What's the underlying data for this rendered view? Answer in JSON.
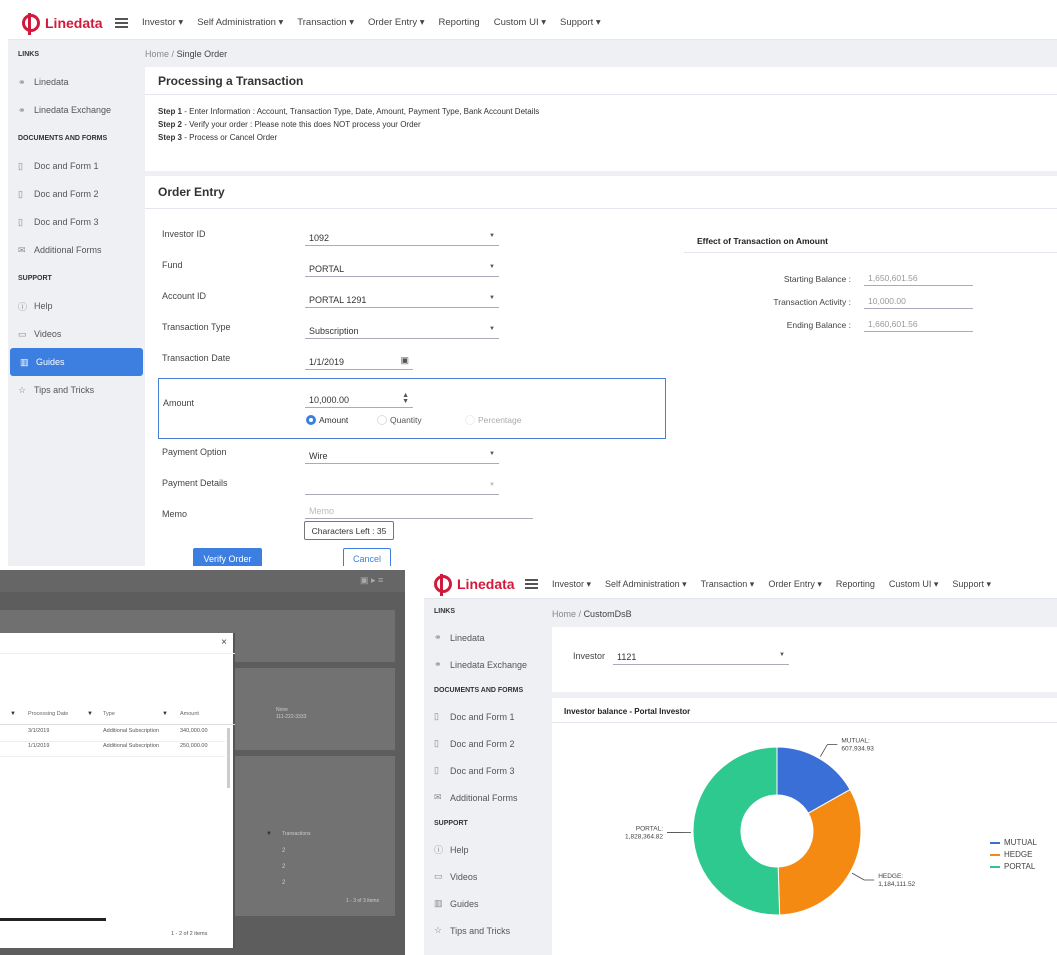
{
  "win1": {
    "logo": "Linedata",
    "menu": [
      "Investor ▾",
      "Self Administration ▾",
      "Transaction ▾",
      "Order Entry ▾",
      "Reporting",
      "Custom UI ▾",
      "Support ▾"
    ],
    "sidebar": {
      "links_title": "LINKS",
      "link1": "Linedata",
      "link2": "Linedata Exchange",
      "docs_title": "DOCUMENTS AND FORMS",
      "doc1": "Doc and Form 1",
      "doc2": "Doc and Form 2",
      "doc3": "Doc and Form 3",
      "doc4": "Additional Forms",
      "support_title": "SUPPORT",
      "help": "Help",
      "videos": "Videos",
      "guides": "Guides",
      "tips": "Tips and Tricks"
    },
    "breadcrumb": {
      "home": "Home",
      "sep": "/",
      "page": "Single Order"
    },
    "processing": {
      "title": "Processing a Transaction",
      "step1_label": "Step 1",
      "step1_text": " - Enter Information : Account, Transaction Type, Date, Amount, Payment Type, Bank Account Details",
      "step2_label": "Step 2",
      "step2_text": " - Verify your order : Please note this does NOT process your Order",
      "step3_label": "Step 3",
      "step3_text": " - Process or Cancel Order"
    },
    "order": {
      "title": "Order Entry",
      "investor_label": "Investor ID",
      "investor_value": "1092",
      "fund_label": "Fund",
      "fund_value": "PORTAL",
      "account_label": "Account ID",
      "account_value": "PORTAL 1291",
      "type_label": "Transaction Type",
      "type_value": "Subscription",
      "date_label": "Transaction Date",
      "date_value": "1/1/2019",
      "amount_label": "Amount",
      "amount_value": "10,000.00",
      "radio_amount": "Amount",
      "radio_quantity": "Quantity",
      "radio_percentage": "Percentage",
      "payment_label": "Payment Option",
      "payment_value": "Wire",
      "details_label": "Payment Details",
      "details_value": "",
      "memo_label": "Memo",
      "memo_placeholder": "Memo",
      "chars_left": "Characters Left : 35",
      "verify": "Verify Order",
      "cancel": "Cancel"
    },
    "effect": {
      "title": "Effect of Transaction on Amount",
      "start_label": "Starting Balance :",
      "start_value": "1,650,601.56",
      "activity_label": "Transaction Activity :",
      "activity_value": "10,000.00",
      "end_label": "Ending Balance :",
      "end_value": "1,660,601.56"
    }
  },
  "win2": {
    "col_processing": "Processing Date",
    "col_type": "Type",
    "col_amount": "Amount",
    "rows": [
      {
        "date": "3/1/2019",
        "type": "Additional Subscription",
        "amount": "340,000.00"
      },
      {
        "date": "1/1/2019",
        "type": "Additional Subscription",
        "amount": "250,000.00"
      }
    ],
    "footer": "1 - 2 of 2 items",
    "bg_none": "None",
    "bg_phone": "111-222-3333",
    "bg_col": "Transactions",
    "bg_vals": [
      "2",
      "2",
      "2"
    ],
    "bg_footer": "1 - 3 of 3 items",
    "close": "×"
  },
  "win3": {
    "logo": "Linedata",
    "menu": [
      "Investor ▾",
      "Self Administration ▾",
      "Transaction ▾",
      "Order Entry ▾",
      "Reporting",
      "Custom UI ▾",
      "Support ▾"
    ],
    "sidebar": {
      "links_title": "LINKS",
      "link1": "Linedata",
      "link2": "Linedata Exchange",
      "docs_title": "DOCUMENTS AND FORMS",
      "doc1": "Doc and Form 1",
      "doc2": "Doc and Form 2",
      "doc3": "Doc and Form 3",
      "doc4": "Additional Forms",
      "support_title": "SUPPORT",
      "help": "Help",
      "videos": "Videos",
      "guides": "Guides",
      "tips": "Tips and Tricks"
    },
    "breadcrumb": {
      "home": "Home",
      "sep": "/",
      "page": "CustomDsB"
    },
    "investor_label": "Investor",
    "investor_value": "1121",
    "chart_title": "Investor balance - Portal Investor"
  },
  "chart_data": {
    "type": "pie",
    "title": "Investor balance - Portal Investor",
    "categories": [
      "MUTUAL",
      "HEDGE",
      "PORTAL"
    ],
    "values": [
      607934.93,
      1184111.52,
      1828364.82
    ],
    "labels": [
      "MUTUAL:\n607,934.93",
      "HEDGE:\n1,184,111.52",
      "PORTAL:\n1,828,364.82"
    ],
    "colors": [
      "#3a6fd8",
      "#f58a12",
      "#2ec98e"
    ],
    "legend": "right"
  },
  "colors": {
    "accent": "#3d7fe0",
    "brand": "#d11a3b"
  }
}
